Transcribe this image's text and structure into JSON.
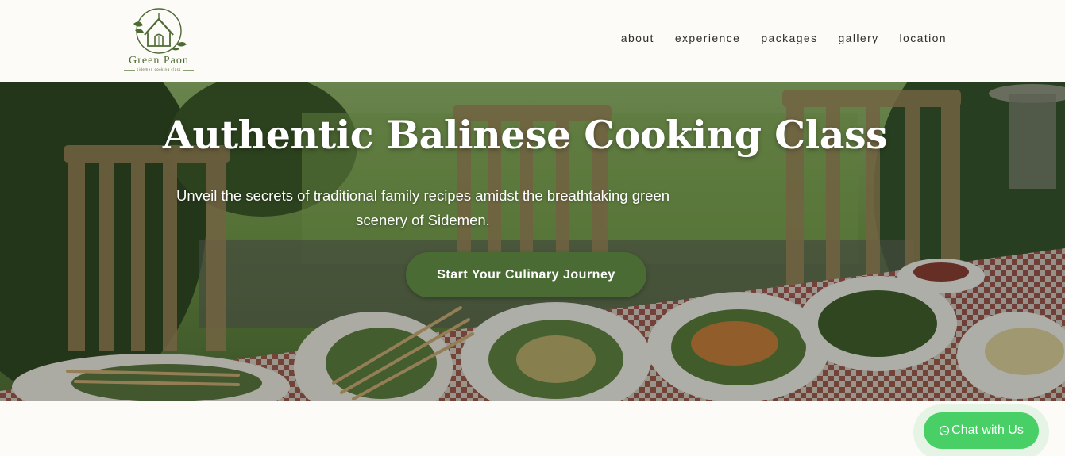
{
  "brand": {
    "name": "Green Paon",
    "tagline": "sidemen cooking class",
    "logo_icon": "house-leaf-logo",
    "color": "#4e6a33"
  },
  "nav": {
    "items": [
      {
        "label": "about"
      },
      {
        "label": "experience"
      },
      {
        "label": "packages"
      },
      {
        "label": "gallery"
      },
      {
        "label": "location"
      }
    ]
  },
  "hero": {
    "title": "Authentic Balinese Cooking Class",
    "subtitle": "Unveil the secrets of traditional family recipes amidst the breathtaking green scenery of Sidemen.",
    "cta_label": "Start Your Culinary Journey",
    "cta_color": "#4b6b35",
    "background_icon": "balinese-food-table-photo"
  },
  "chat": {
    "label": "Chat with Us",
    "icon": "whatsapp-icon",
    "color": "#48d066"
  }
}
